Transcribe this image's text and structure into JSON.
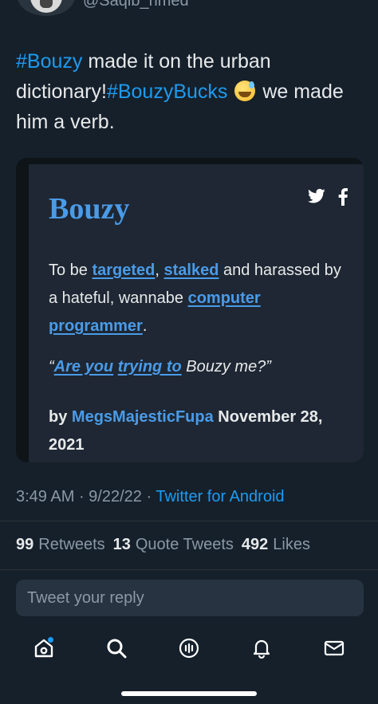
{
  "header": {
    "handle": "@Saqib_hmed"
  },
  "tweet": {
    "part1_tag": "#Bouzy",
    "part2": " made it on the urban dictionary!",
    "part3_tag": "#BouzyBucks",
    "part4": " we made him a verb.",
    "emoji": "grinning-face-with-sweat"
  },
  "card": {
    "title": "Bouzy",
    "def_1": "To be ",
    "def_link_1": "targeted",
    "def_2": ", ",
    "def_link_2": "stalked",
    "def_3": " and harassed by a hateful, wannabe ",
    "def_link_3": "computer programmer",
    "def_4": ".",
    "ex_open": "“",
    "ex_link_1": "Are you",
    "ex_space": " ",
    "ex_link_2": "trying to",
    "ex_rest": " Bouzy me?”",
    "by_label": "by ",
    "author": "MegsMajesticFupa",
    "date": " November 28, 2021",
    "icons": [
      "twitter-icon",
      "facebook-icon"
    ]
  },
  "meta": {
    "time": "3:49 AM",
    "sep1": " · ",
    "date": "9/22/22",
    "sep2": " · ",
    "source": "Twitter for Android"
  },
  "stats": {
    "retweets_count": "99",
    "retweets_label": "Retweets",
    "quotes_count": "13",
    "quotes_label": "Quote Tweets",
    "likes_count": "492",
    "likes_label": "Likes"
  },
  "reply": {
    "placeholder": "Tweet your reply"
  },
  "nav": {
    "items": [
      "home-icon",
      "search-icon",
      "spaces-icon",
      "notifications-icon",
      "messages-icon"
    ]
  },
  "colors": {
    "background": "#15202b",
    "accent": "#1d9bf0",
    "card_link": "#4a9be8"
  }
}
